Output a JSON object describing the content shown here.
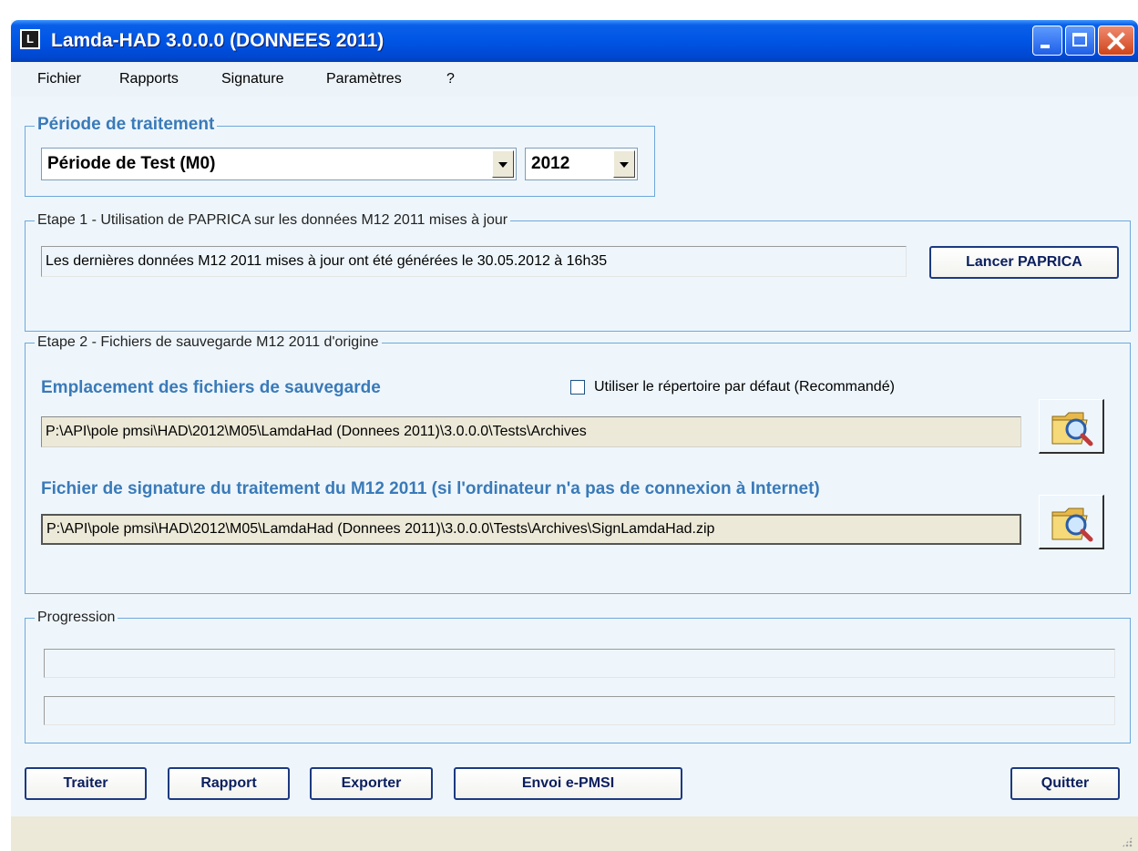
{
  "window": {
    "title": "Lamda-HAD 3.0.0.0 (DONNEES 2011)",
    "icon_glyph": "L"
  },
  "menu": [
    "Fichier",
    "Rapports",
    "Signature",
    "Paramètres",
    "?"
  ],
  "periode": {
    "label": "Période de traitement",
    "selected_period": "Période de Test (M0)",
    "selected_year": "2012"
  },
  "etape1": {
    "label": "Etape 1 - Utilisation de PAPRICA sur les données M12 2011 mises à jour",
    "status": "Les dernières données M12 2011 mises à jour ont été générées le 30.05.2012 à 16h35",
    "button": "Lancer PAPRICA"
  },
  "etape2": {
    "label": "Etape 2 - Fichiers de sauvegarde M12 2011 d'origine",
    "location_title": "Emplacement des fichiers de sauvegarde",
    "default_dir_checkbox": {
      "label": "Utiliser le répertoire par défaut (Recommandé)",
      "checked": false
    },
    "location_path": "P:\\API\\pole pmsi\\HAD\\2012\\M05\\LamdaHad (Donnees 2011)\\3.0.0.0\\Tests\\Archives",
    "signature_title": "Fichier de signature du traitement du M12 2011 (si l'ordinateur n'a pas de connexion à Internet)",
    "signature_path": "P:\\API\\pole pmsi\\HAD\\2012\\M05\\LamdaHad (Donnees 2011)\\3.0.0.0\\Tests\\Archives\\SignLamdaHad.zip"
  },
  "progression": {
    "label": "Progression"
  },
  "buttons": {
    "traiter": "Traiter",
    "rapport": "Rapport",
    "exporter": "Exporter",
    "envoi": "Envoi e-PMSI",
    "quitter": "Quitter"
  },
  "colors": {
    "titlebar": "#0055e5",
    "window_bg": "#eef6fc",
    "group_border": "#6ea8da",
    "section_title": "#3a7ab8",
    "button_text": "#0b1f5e"
  },
  "icons": {
    "browse": "folder-search-icon"
  }
}
